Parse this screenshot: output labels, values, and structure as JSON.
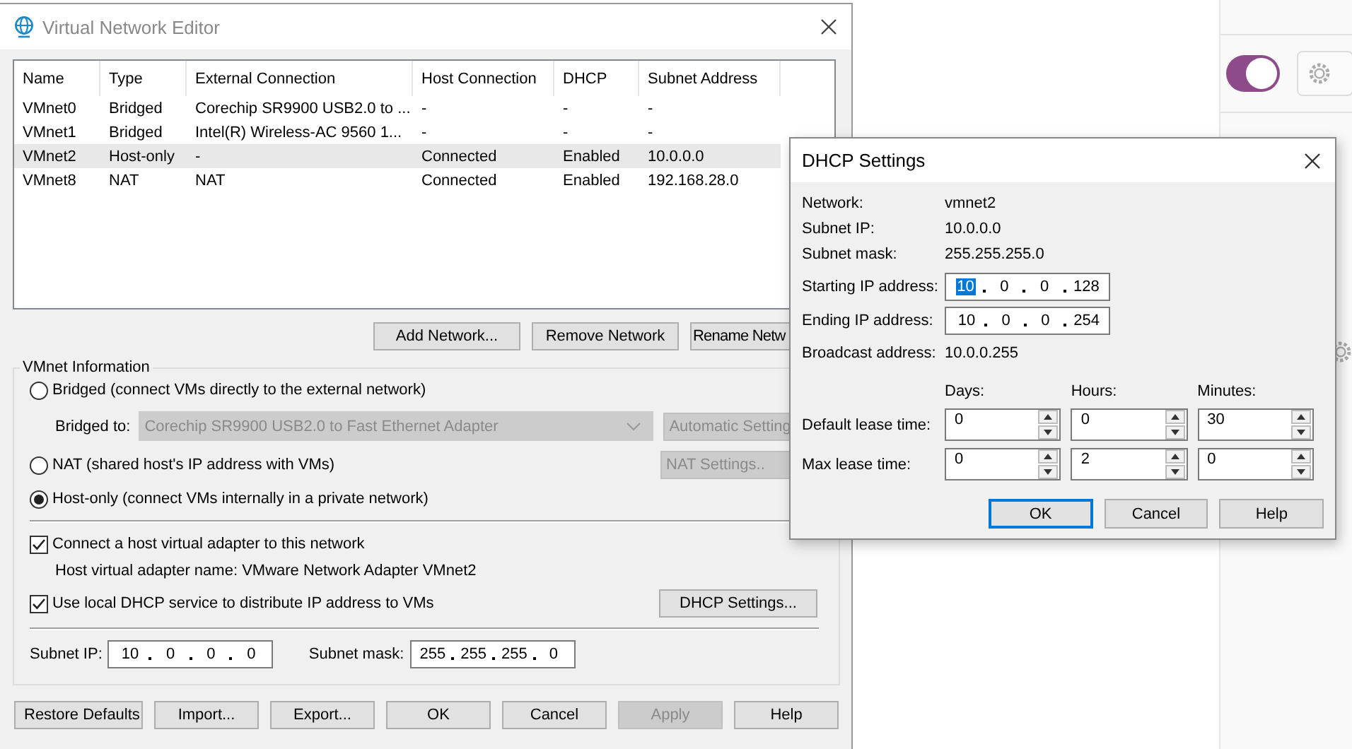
{
  "background_panel": {
    "toggle": {
      "on": true
    }
  },
  "main_window": {
    "title": "Virtual Network Editor",
    "table": {
      "columns": [
        "Name",
        "Type",
        "External Connection",
        "Host Connection",
        "DHCP",
        "Subnet Address"
      ],
      "rows": [
        {
          "cells": [
            "VMnet0",
            "Bridged",
            "Corechip SR9900 USB2.0 to ...",
            "-",
            "-",
            "-"
          ],
          "selected": false
        },
        {
          "cells": [
            "VMnet1",
            "Bridged",
            "Intel(R) Wireless-AC 9560 1...",
            "-",
            "-",
            "-"
          ],
          "selected": false
        },
        {
          "cells": [
            "VMnet2",
            "Host-only",
            "-",
            "Connected",
            "Enabled",
            "10.0.0.0"
          ],
          "selected": true
        },
        {
          "cells": [
            "VMnet8",
            "NAT",
            "NAT",
            "Connected",
            "Enabled",
            "192.168.28.0"
          ],
          "selected": false
        }
      ]
    },
    "list_buttons": [
      {
        "label": "Add Network...",
        "cut": false
      },
      {
        "label": "Remove Network",
        "cut": false
      },
      {
        "label": "Rename Netw",
        "cut": true
      }
    ],
    "vmnet_info": {
      "title": "VMnet Information",
      "modes": [
        {
          "label": "Bridged (connect VMs directly to the external network)",
          "selected": false
        },
        {
          "label": "NAT (shared host's IP address with VMs)",
          "selected": false
        },
        {
          "label": "Host-only (connect VMs internally in a private network)",
          "selected": true
        }
      ],
      "bridged_to": {
        "label": "Bridged to:",
        "value": "Corechip SR9900 USB2.0 to Fast Ethernet Adapter",
        "disabled": true
      },
      "automatic_settings": {
        "label": "Automatic Setting",
        "disabled": true
      },
      "nat_settings": {
        "label": "NAT Settings..",
        "disabled": true
      },
      "connect_adapter": {
        "label": "Connect a host virtual adapter to this network",
        "checked": true
      },
      "adapter_name": "Host virtual adapter name: VMware Network Adapter VMnet2",
      "use_dhcp": {
        "label": "Use local DHCP service to distribute IP address to VMs",
        "checked": true
      },
      "dhcp_settings_button": "DHCP Settings...",
      "subnet_ip": {
        "label": "Subnet IP:",
        "octets": [
          "10",
          "0",
          "0",
          "0"
        ]
      },
      "subnet_mask": {
        "label": "Subnet mask:",
        "octets": [
          "255",
          "255",
          "255",
          "0"
        ]
      }
    },
    "buttons": [
      {
        "label": "Restore Defaults",
        "disabled": false
      },
      {
        "label": "Import...",
        "disabled": false
      },
      {
        "label": "Export...",
        "disabled": false
      },
      {
        "label": "OK",
        "disabled": false
      },
      {
        "label": "Cancel",
        "disabled": false
      },
      {
        "label": "Apply",
        "disabled": true
      },
      {
        "label": "Help",
        "disabled": false
      }
    ]
  },
  "dhcp_dialog": {
    "title": "DHCP Settings",
    "info": [
      {
        "label": "Network:",
        "value": "vmnet2"
      },
      {
        "label": "Subnet IP:",
        "value": "10.0.0.0"
      },
      {
        "label": "Subnet mask:",
        "value": "255.255.255.0"
      }
    ],
    "starting_ip": {
      "label": "Starting IP address:",
      "octets": [
        {
          "value": "10",
          "selected": true
        },
        {
          "value": "0",
          "selected": false
        },
        {
          "value": "0",
          "selected": false
        },
        {
          "value": "128",
          "selected": false
        }
      ]
    },
    "ending_ip": {
      "label": "Ending IP address:",
      "octets": [
        {
          "value": "10",
          "selected": false
        },
        {
          "value": "0",
          "selected": false
        },
        {
          "value": "0",
          "selected": false
        },
        {
          "value": "254",
          "selected": false
        }
      ]
    },
    "broadcast": {
      "label": "Broadcast address:",
      "value": "10.0.0.255"
    },
    "lease_headers": [
      "Days:",
      "Hours:",
      "Minutes:"
    ],
    "lease_rows": [
      {
        "label": "Default lease time:",
        "values": [
          "0",
          "0",
          "30"
        ]
      },
      {
        "label": "Max lease time:",
        "values": [
          "0",
          "2",
          "0"
        ]
      }
    ],
    "buttons": [
      {
        "label": "OK",
        "focused": true
      },
      {
        "label": "Cancel",
        "focused": false
      },
      {
        "label": "Help",
        "focused": false
      }
    ]
  }
}
